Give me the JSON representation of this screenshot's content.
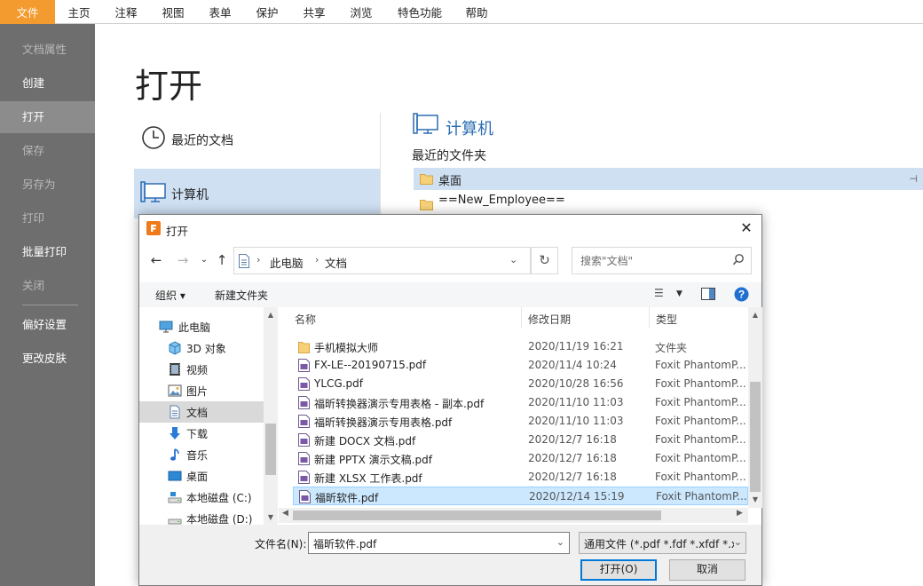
{
  "menu": {
    "tabs": [
      "文件",
      "主页",
      "注释",
      "视图",
      "表单",
      "保护",
      "共享",
      "浏览",
      "特色功能",
      "帮助"
    ]
  },
  "leftnav": {
    "items": [
      "文档属性",
      "创建",
      "打开",
      "保存",
      "另存为",
      "打印",
      "批量打印",
      "关闭",
      "偏好设置",
      "更改皮肤"
    ]
  },
  "open_page": {
    "title": "打开",
    "places": [
      "最近的文档",
      "计算机"
    ],
    "computer_heading": "计算机",
    "recent_folders_label": "最近的文件夹",
    "recent_folders": [
      "桌面",
      "==New_Employee=="
    ]
  },
  "dialog": {
    "title": "打开",
    "address": [
      "此电脑",
      "文档"
    ],
    "search_placeholder": "搜索\"文档\"",
    "toolbar": {
      "organize": "组织 ▾",
      "new_folder": "新建文件夹"
    },
    "tree": [
      "此电脑",
      "3D 对象",
      "视频",
      "图片",
      "文档",
      "下载",
      "音乐",
      "桌面",
      "本地磁盘 (C:)",
      "本地磁盘 (D:)"
    ],
    "columns": [
      "名称",
      "修改日期",
      "类型"
    ],
    "files": [
      {
        "name": "手机模拟大师",
        "date": "2020/11/19 16:21",
        "type": "文件夹",
        "kind": "folder"
      },
      {
        "name": "FX-LE--20190715.pdf",
        "date": "2020/11/4 10:24",
        "type": "Foxit PhantomP...",
        "kind": "pdf"
      },
      {
        "name": "YLCG.pdf",
        "date": "2020/10/28 16:56",
        "type": "Foxit PhantomP...",
        "kind": "pdf"
      },
      {
        "name": "福昕转换器演示专用表格 - 副本.pdf",
        "date": "2020/11/10 11:03",
        "type": "Foxit PhantomP...",
        "kind": "pdf"
      },
      {
        "name": "福昕转换器演示专用表格.pdf",
        "date": "2020/11/10 11:03",
        "type": "Foxit PhantomP...",
        "kind": "pdf"
      },
      {
        "name": "新建 DOCX 文档.pdf",
        "date": "2020/12/7 16:18",
        "type": "Foxit PhantomP...",
        "kind": "pdf"
      },
      {
        "name": "新建 PPTX 演示文稿.pdf",
        "date": "2020/12/7 16:18",
        "type": "Foxit PhantomP...",
        "kind": "pdf"
      },
      {
        "name": "新建 XLSX 工作表.pdf",
        "date": "2020/12/7 16:18",
        "type": "Foxit PhantomP...",
        "kind": "pdf"
      },
      {
        "name": "福昕软件.pdf",
        "date": "2020/12/14 15:19",
        "type": "Foxit PhantomP...",
        "kind": "pdf",
        "selected": true
      }
    ],
    "filename_label": "文件名(N):",
    "filename_value": "福昕软件.pdf",
    "filetype_value": "通用文件 (*.pdf *.fdf *.xfdf *.x",
    "open_button": "打开(O)",
    "cancel_button": "取消"
  },
  "colors": {
    "file_tab": "#f39b2e",
    "leftnav_bg": "#6e6e6e",
    "selection": "#cfe0f3",
    "accent_blue": "#2b6cb3"
  }
}
